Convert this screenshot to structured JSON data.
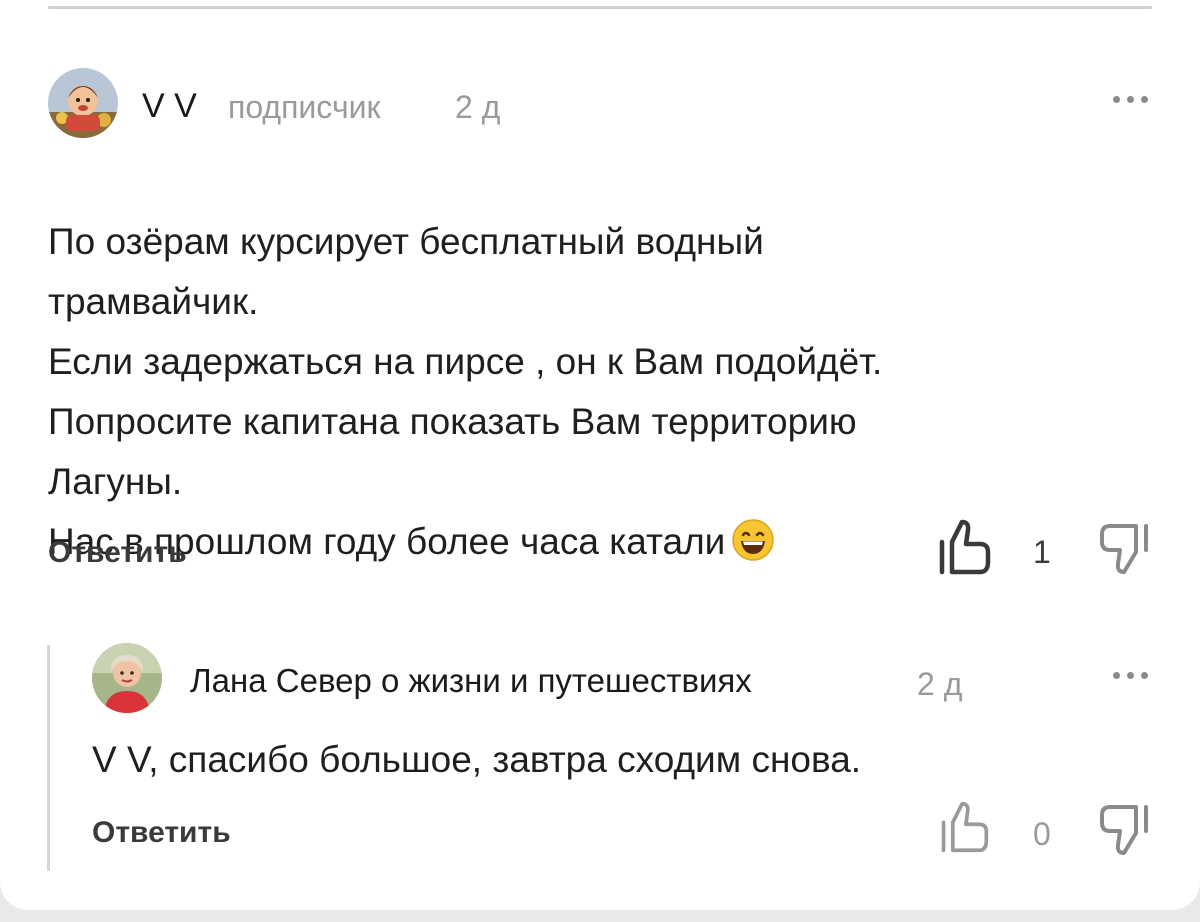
{
  "comment": {
    "author": "V V",
    "badge": "подписчик",
    "time": "2 д",
    "text": "По озёрам курсирует бесплатный водный\nтрамвайчик.\nЕсли задержаться на пирсе , он к Вам подойдёт.\nПопросите капитана показать Вам территорию\nЛагуны.\nНас в прошлом году более часа катали",
    "reply_label": "Ответить",
    "likes": "1",
    "emoji": "grinning-face-emoji"
  },
  "reply": {
    "author": "Лана Север о жизни и путешествиях",
    "time": "2 д",
    "text": "V V, спасибо большое, завтра сходим снова.",
    "reply_label": "Ответить",
    "likes": "0"
  },
  "icons": {
    "more": "more-dots-icon",
    "like": "thumbs-up-icon",
    "dislike": "thumbs-down-icon"
  },
  "colors": {
    "text": "#1f1f1f",
    "muted": "#9a9a9a",
    "icon_active": "#3a3a3a",
    "icon_muted": "#9a9a9a"
  }
}
